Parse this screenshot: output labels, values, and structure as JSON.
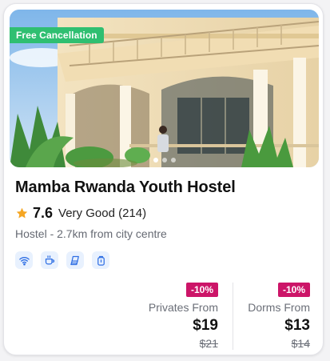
{
  "card": {
    "badge": "Free Cancellation",
    "title": "Mamba Rwanda Youth Hostel",
    "rating": {
      "score": "7.6",
      "label": "Very Good (214)"
    },
    "location": "Hostel - 2.7km from city centre",
    "facilities": [
      "wifi-icon",
      "coffee-icon",
      "towel-icon",
      "lock-icon"
    ],
    "carousel": {
      "count": 3,
      "active": 0
    },
    "prices": {
      "privates": {
        "discount": "-10%",
        "label": "Privates From",
        "price": "$19",
        "old_price": "$21"
      },
      "dorms": {
        "discount": "-10%",
        "label": "Dorms From",
        "price": "$13",
        "old_price": "$14"
      }
    }
  },
  "colors": {
    "badge_green": "#2fbf71",
    "discount_magenta": "#cc1568",
    "star_orange": "#f5a623",
    "facility_blue": "#2f6fe4"
  }
}
